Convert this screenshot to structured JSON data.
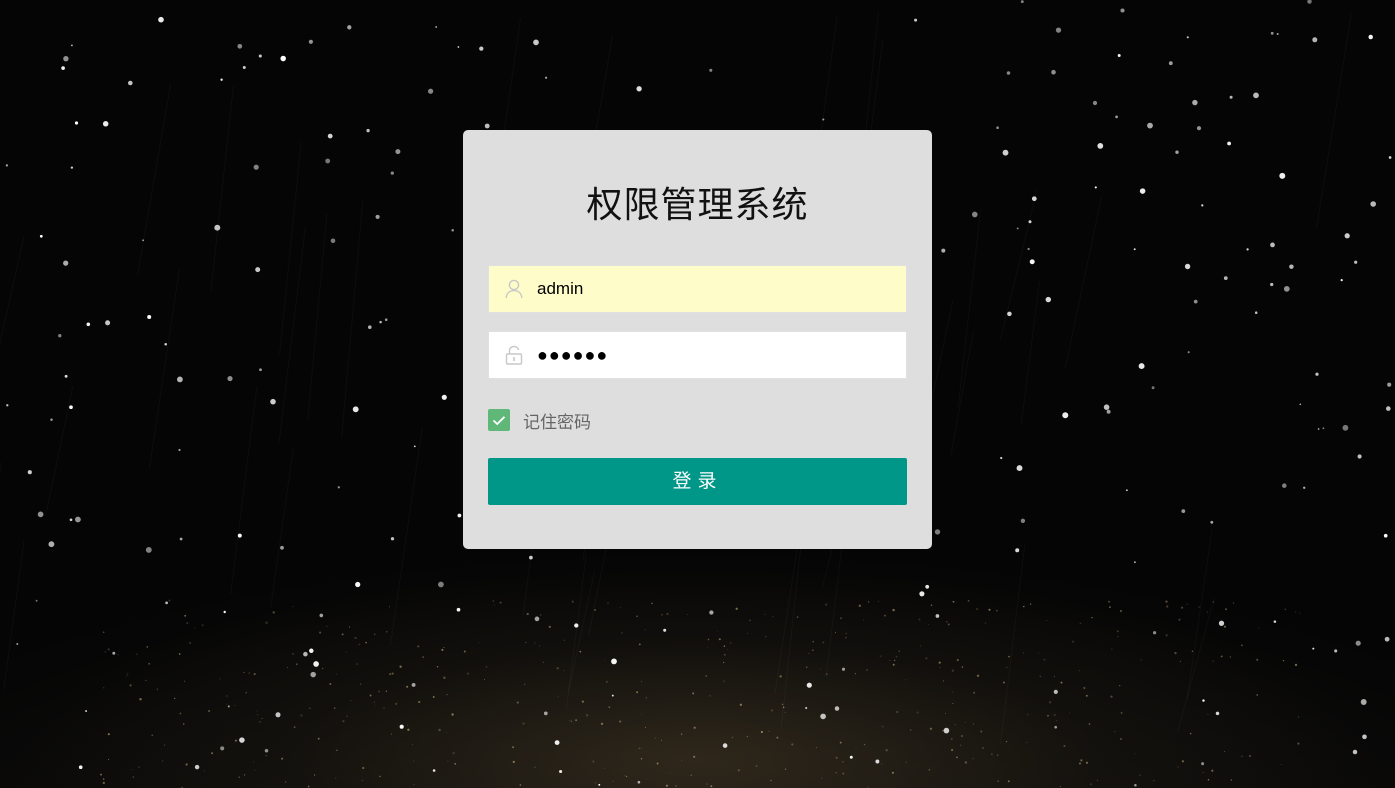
{
  "page": {
    "title": "权限管理系统"
  },
  "login_form": {
    "username_value": "admin",
    "username_icon": "user-icon",
    "password_value": "●●●●●●",
    "password_icon": "lock-icon",
    "remember_label": "记住密码",
    "remember_checked": true,
    "submit_label": "登录"
  },
  "colors": {
    "background": "#050505",
    "card": "#dedede",
    "username_field_bg": "#fefcc8",
    "checkbox": "#5fb878",
    "primary_button": "#009688"
  }
}
